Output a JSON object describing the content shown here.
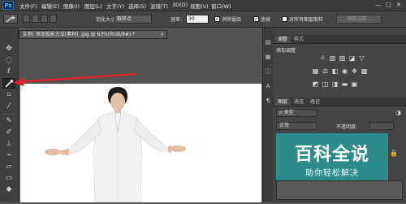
{
  "app": {
    "logo": "Ps"
  },
  "menu": [
    "文件(F)",
    "编辑(E)",
    "图像(I)",
    "图层(L)",
    "文字(Y)",
    "选择(S)",
    "滤镜(T)",
    "3D(D)",
    "视图(V)",
    "窗口(W)"
  ],
  "window_controls": {
    "minimize": "—",
    "restore": "□",
    "close": "✕"
  },
  "options": {
    "feather_label": "羽化大小:",
    "feather_value": "取样点",
    "tolerance_label": "容差:",
    "tolerance_value": "30",
    "antialias_label": "消除锯齿",
    "contiguous_label": "连续",
    "all_layers_label": "对所有图层取样",
    "refine_button": "调整边缘..."
  },
  "document": {
    "tab_title": "实例: 添加投影方法(素材) .jpg @ 63%(RGB/8#) *",
    "close": "×"
  },
  "panels": {
    "adjust_tabs": [
      "调整",
      "样式"
    ],
    "adjust_title": "添加调整",
    "layers_tabs": [
      "图层",
      "通道",
      "路径"
    ],
    "kind_label": "ρ 类型",
    "blend_mode": "正常",
    "opacity_label": "不透明度:"
  },
  "watermark": {
    "title": "百科全说",
    "subtitle": "助你轻松解决"
  },
  "colors": {
    "annotation_arrow": "#e8202a",
    "watermark_bg": "#2e8b8b"
  }
}
